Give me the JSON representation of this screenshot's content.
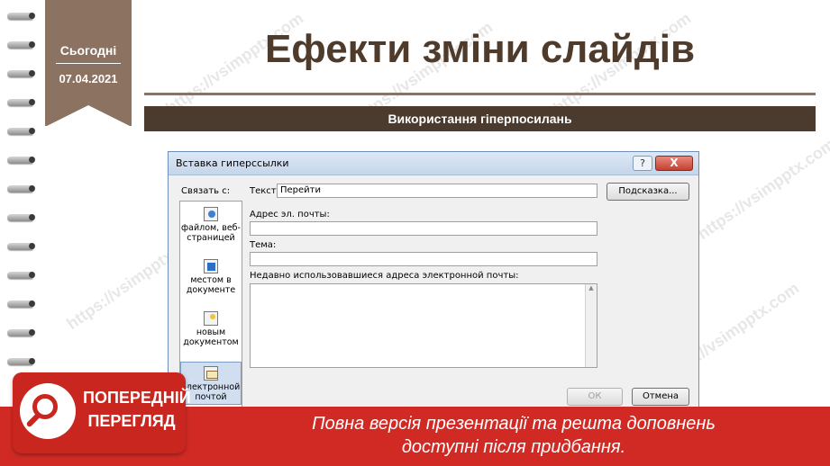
{
  "ribbon": {
    "today_label": "Сьогодні",
    "date": "07.04.2021"
  },
  "slide": {
    "title": "Ефекти зміни слайдів",
    "subtitle": "Використання гіперпосилань"
  },
  "dialog": {
    "title": "Вставка гиперссылки",
    "help_label": "?",
    "close_label": "X",
    "link_to_label": "Связать с:",
    "text_label": "Текст:",
    "text_value": "Перейти",
    "tooltip_button": "Подсказка...",
    "link_items": [
      {
        "label": "файлом, веб-страницей",
        "icon": "web-page-icon"
      },
      {
        "label": "местом в документе",
        "icon": "place-in-document-icon"
      },
      {
        "label": "новым документом",
        "icon": "new-document-icon"
      },
      {
        "label": "электронной почтой",
        "icon": "email-icon"
      }
    ],
    "email_label": "Адрес эл. почты:",
    "email_value": "",
    "subject_label": "Тема:",
    "subject_value": "",
    "recent_label": "Недавно использовавшиеся адреса электронной почты:",
    "ok_label": "ОК",
    "cancel_label": "Отмена"
  },
  "watermark": "https://vsimpptx.com",
  "banner": {
    "badge_line1": "ПОПЕРЕДНІЙ",
    "badge_line2": "ПЕРЕГЛЯД",
    "text_line1": "Повна версія презентації та решта доповнень",
    "text_line2": "доступні після придбання."
  },
  "colors": {
    "ribbon": "#8c7261",
    "title": "#4e3b2c",
    "subtitle_bar": "#4b3a2e",
    "banner": "#d12a24"
  }
}
